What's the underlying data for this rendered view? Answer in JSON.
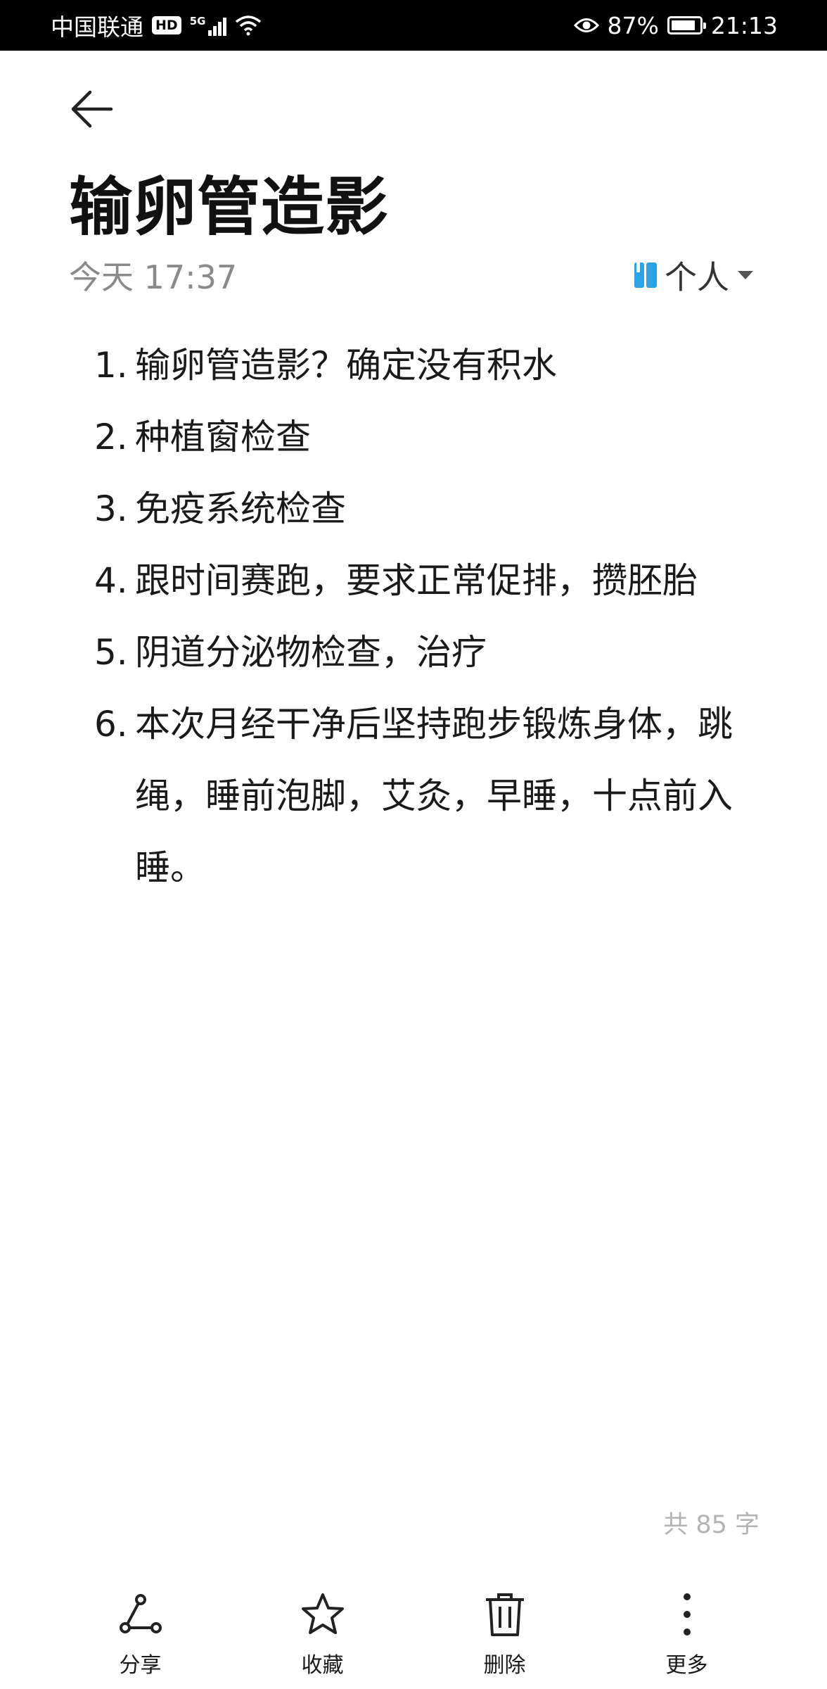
{
  "status_bar": {
    "carrier": "中国联通",
    "hd_badge": "HD",
    "network": "5G",
    "battery": "87%",
    "battery_level": 0.87,
    "time": "21:13"
  },
  "header": {
    "back_icon": "arrow-left-icon",
    "title": "输卵管造影",
    "time": "今天 17:37",
    "category_label": "个人",
    "category_color": "#2aa3e6"
  },
  "items": [
    {
      "num": "1.",
      "text": "输卵管造影？确定没有积水"
    },
    {
      "num": "2.",
      "text": "种植窗检查"
    },
    {
      "num": "3.",
      "text": "免疫系统检查"
    },
    {
      "num": "4.",
      "text": "跟时间赛跑，要求正常促排，攒胚胎"
    },
    {
      "num": "5.",
      "text": "阴道分泌物检查，治疗"
    },
    {
      "num": "6.",
      "text": "本次月经干净后坚持跑步锻炼身体，跳绳，睡前泡脚，艾灸，早睡，十点前入睡。"
    }
  ],
  "word_count": "共 85 字",
  "toolbar": {
    "share": "分享",
    "favorite": "收藏",
    "delete": "删除",
    "more": "更多"
  }
}
